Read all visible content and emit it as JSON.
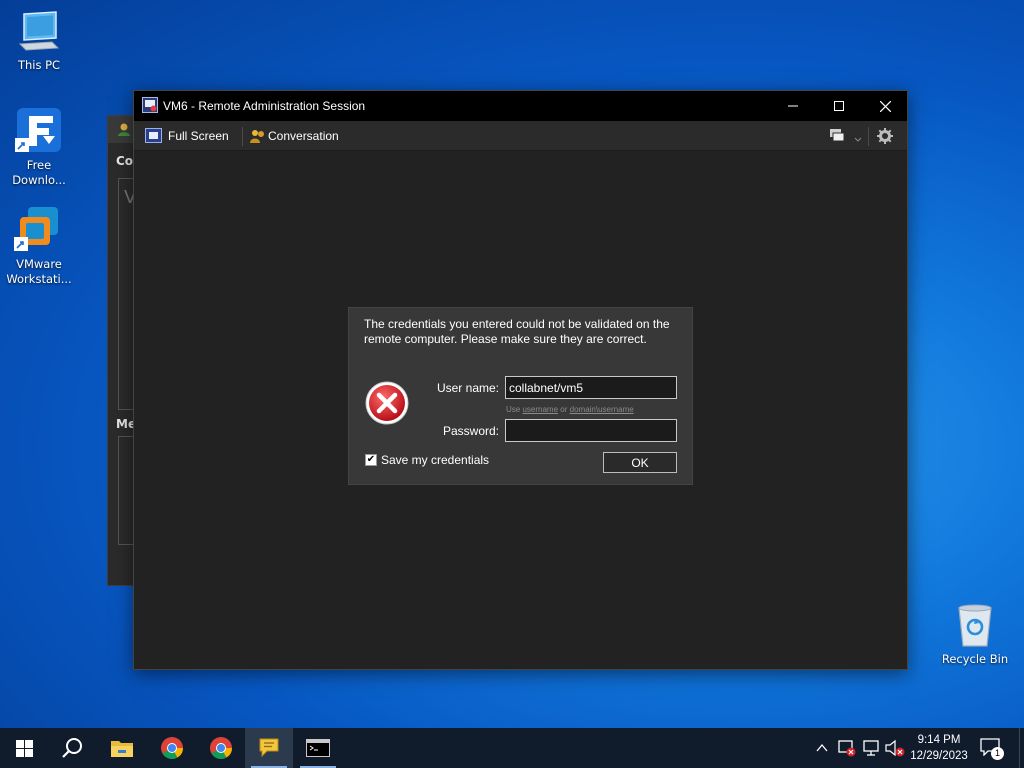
{
  "desktop": {
    "icons": [
      {
        "label": "This PC"
      },
      {
        "label": "Free Downlo..."
      },
      {
        "label": "VMware Workstati..."
      },
      {
        "label": "Recycle Bin"
      }
    ]
  },
  "background_window": {
    "heading_1": "Cor",
    "heading_2": "Me",
    "box_letter": "V"
  },
  "window": {
    "title": "VM6 - Remote Administration Session",
    "toolbar": {
      "full_screen": "Full Screen",
      "conversation": "Conversation"
    }
  },
  "dialog": {
    "message": "The credentials you entered could not be validated on the remote computer. Please make sure they are correct.",
    "username_label": "User name:",
    "username_value": "collabnet/vm5",
    "hint_prefix": "Use",
    "hint_link1": "username",
    "hint_or": "or",
    "hint_link2": "domain\\username",
    "password_label": "Password:",
    "password_value": "",
    "save_credentials_label": "Save my credentials",
    "save_credentials_checked": true,
    "ok_label": "OK"
  },
  "taskbar": {
    "time": "9:14 PM",
    "date": "12/29/2023",
    "notification_count": "1"
  },
  "colors": {
    "desktop_accent": "#0a64d6",
    "taskbar": "#101c2c",
    "error_red": "#d42028"
  }
}
